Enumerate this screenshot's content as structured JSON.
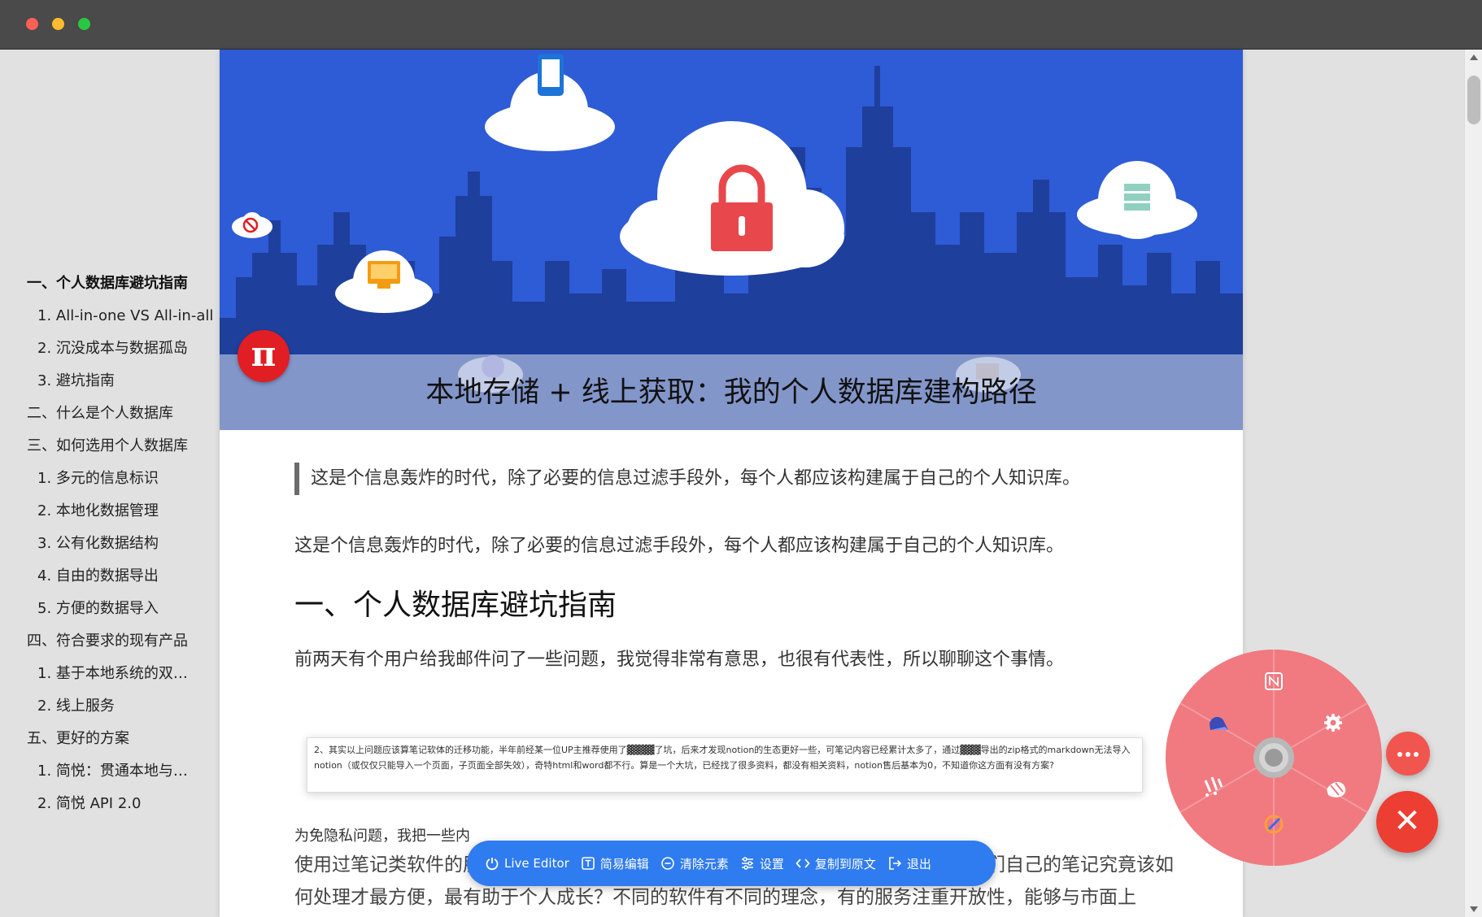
{
  "window": {
    "controls": [
      "close",
      "minimize",
      "maximize"
    ]
  },
  "outline": {
    "items": [
      {
        "label": "一、个人数据库避坑指南",
        "level": 1,
        "active": true
      },
      {
        "label": "1. All-in-one VS All-in-all",
        "level": 2
      },
      {
        "label": "2. 沉没成本与数据孤岛",
        "level": 2
      },
      {
        "label": "3. 避坑指南",
        "level": 2
      },
      {
        "label": "二、什么是个人数据库",
        "level": 1
      },
      {
        "label": "三、如何选用个人数据库",
        "level": 1
      },
      {
        "label": "1. 多元的信息标识",
        "level": 2
      },
      {
        "label": "2. 本地化数据管理",
        "level": 2
      },
      {
        "label": "3. 公有化数据结构",
        "level": 2
      },
      {
        "label": "4. 自由的数据导出",
        "level": 2
      },
      {
        "label": "5. 方便的数据导入",
        "level": 2
      },
      {
        "label": "四、符合要求的现有产品",
        "level": 1
      },
      {
        "label": "1. 基于本地系统的双…",
        "level": 2
      },
      {
        "label": "2. 线上服务",
        "level": 2
      },
      {
        "label": "五、更好的方案",
        "level": 1
      },
      {
        "label": "1. 简悦：贯通本地与…",
        "level": 2
      },
      {
        "label": "2. 简悦 API 2.0",
        "level": 2
      }
    ]
  },
  "article": {
    "logo_text": "π",
    "title": "本地存储 + 线上获取：我的个人数据库建构路径",
    "blockquote": "这是个信息轰炸的时代，除了必要的信息过滤手段外，每个人都应该构建属于自己的个人知识库。",
    "intro": "这是个信息轰炸的时代，除了必要的信息过滤手段外，每个人都应该构建属于自己的个人知识库。",
    "heading1": "一、个人数据库避坑指南",
    "paragraph1": "前两天有个用户给我邮件问了一些问题，我觉得非常有意思，也很有代表性，所以聊聊这个事情。",
    "email_excerpt": "2、其实以上问题应该算笔记软体的迁移功能，半年前经某一位UP主推荐使用了▓▓▓▓了坑，后来才发现notion的生态更好一些，可笔记内容已经累计太多了，通过▓▓▓导出的zip格式的markdown无法导入notion（或仅仅只能导入一个页面，子页面全部失效），奇特html和word都不行。算是一个大坑，已经找了很多资料，都没有相关资料，notion售后基本为0，不知道你这方面有没有方案?",
    "paragraph2_partial": "为免隐私问题，我把一些内",
    "paragraph3": "使用过笔记类软件的朋友都知道，这些软件是否好用可能是一个共性问题，也就是我们自己的笔记究竟该如何处理才最方便，最有助于个人成长？不同的软件有不同的理念，有的服务注重开放性，能够与市面上"
  },
  "toolbar": {
    "buttons": [
      {
        "label": "Live Editor",
        "icon": "power-icon"
      },
      {
        "label": "简易编辑",
        "icon": "text-edit-icon"
      },
      {
        "label": "清除元素",
        "icon": "minus-circle-icon"
      },
      {
        "label": "设置",
        "icon": "sliders-icon"
      },
      {
        "label": "复制到原文",
        "icon": "code-icon"
      },
      {
        "label": "退出",
        "icon": "logout-icon"
      }
    ]
  },
  "radial_menu": {
    "items": [
      "notion-icon",
      "settings-gear-icon",
      "export-icon",
      "mark-icon",
      "highlight-icon",
      "cloud-icon"
    ],
    "colors": {
      "menu": "#f07a80",
      "close": "#ec3e33"
    }
  },
  "fab": {
    "more": "•••",
    "close": "✕"
  }
}
